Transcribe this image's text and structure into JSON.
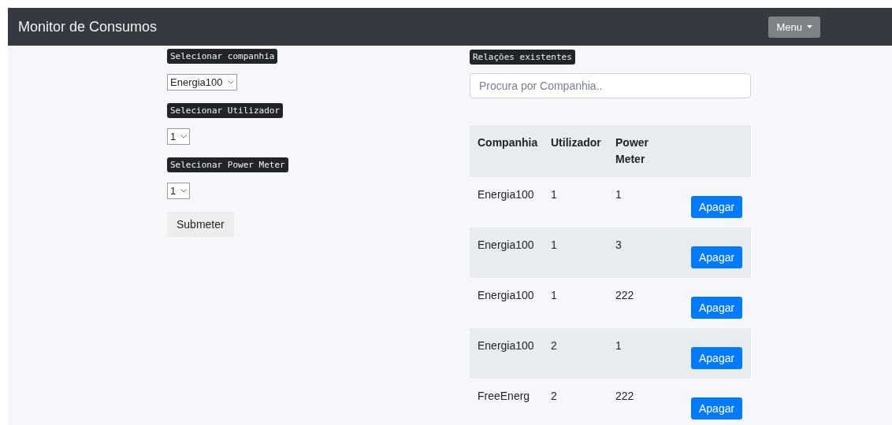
{
  "navbar": {
    "title": "Monitor de Consumos",
    "menu_button": "Menu"
  },
  "form": {
    "fields": [
      {
        "label": "Selecionar companhia",
        "value": "Energia100"
      },
      {
        "label": "Selecionar Utilizador",
        "value": "1"
      },
      {
        "label": "Selecionar Power Meter",
        "value": "1"
      }
    ],
    "submit": "Submeter"
  },
  "relations": {
    "label": "Relações existentes",
    "search": {
      "placeholder": "Procura por Companhia.."
    },
    "table": {
      "columns": [
        "Companhia",
        "Utilizador",
        "Power Meter"
      ],
      "rows": [
        {
          "cells": [
            "Energia100",
            "1",
            "1"
          ],
          "action": "Apagar"
        },
        {
          "cells": [
            "Energia100",
            "1",
            "3"
          ],
          "action": "Apagar"
        },
        {
          "cells": [
            "Energia100",
            "1",
            "222"
          ],
          "action": "Apagar"
        },
        {
          "cells": [
            "Energia100",
            "2",
            "1"
          ],
          "action": "Apagar"
        },
        {
          "cells": [
            "FreeEnerg",
            "2",
            "222"
          ],
          "action": "Apagar"
        }
      ]
    }
  }
}
